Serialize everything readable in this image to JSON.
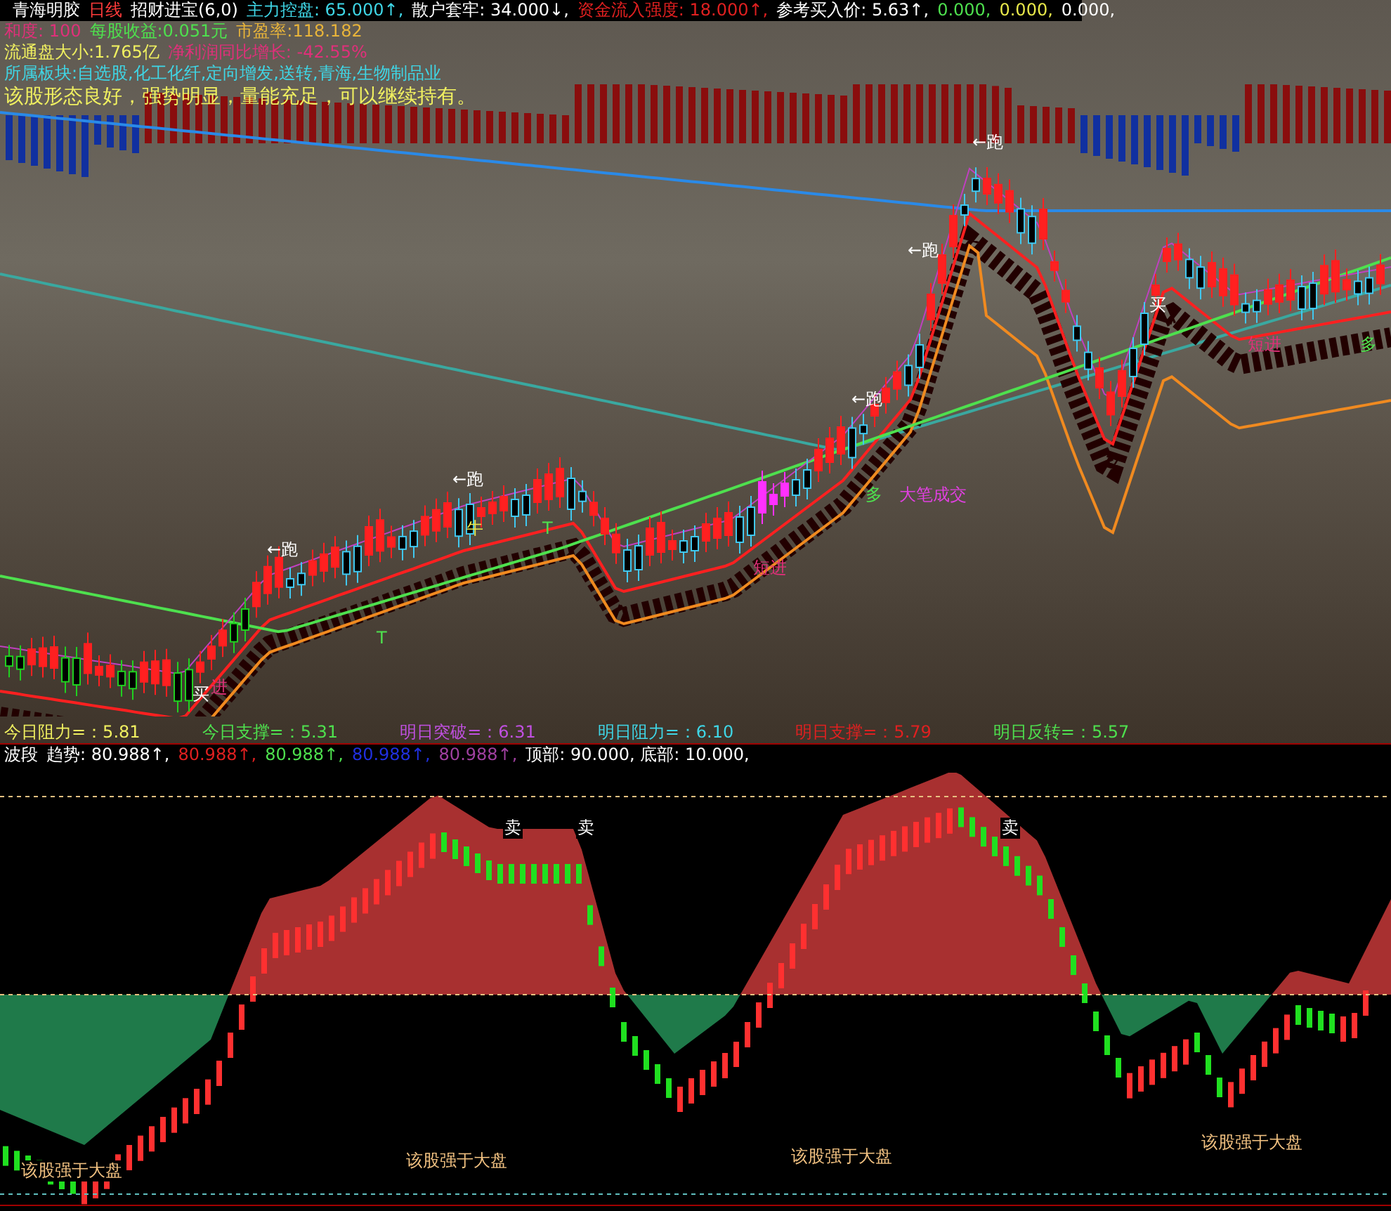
{
  "header_lines": [
    [
      {
        "text": "青海明胶",
        "color": "#ffffff"
      },
      {
        "text": "日线",
        "color": "#ff3b3b"
      },
      {
        "text": "招财进宝(6,0)",
        "color": "#ffffff"
      },
      {
        "text": "主力控盘: 65.000↑,",
        "color": "#3fd6e6"
      },
      {
        "text": "散户套牢: 34.000↓,",
        "color": "#ffffff"
      },
      {
        "text": "资金流入强度: 18.000↑,",
        "color": "#e02020"
      },
      {
        "text": "参考买入价: 5.63↑,",
        "color": "#ffffff"
      },
      {
        "text": "0.000,",
        "color": "#4ee04e"
      },
      {
        "text": "0.000,",
        "color": "#e8e84a"
      },
      {
        "text": "0.000,",
        "color": "#ffffff"
      }
    ],
    [
      {
        "text": "和度: 100",
        "color": "#e0307a"
      },
      {
        "text": "每股收益:0.051元",
        "color": "#4ee04e"
      },
      {
        "text": "市盈率:118.182",
        "color": "#e8b43a"
      }
    ],
    [
      {
        "text": "流通盘大小:1.765亿",
        "color": "#f0f060"
      },
      {
        "text": "净利润同比增长: -42.55%",
        "color": "#e0307a"
      }
    ],
    [
      {
        "text": "所属板块:自选股,化工化纤,定向增发,送转,青海,生物制品业",
        "color": "#3fd6e6"
      }
    ],
    [
      {
        "text": "该股形态良好，强势明显，量能充足，可以继续持有。",
        "color": "#f0f060"
      }
    ]
  ],
  "chart_labels": [
    {
      "text": "←跑",
      "color": "#ffffff"
    },
    {
      "text": "←跑",
      "color": "#ffffff"
    },
    {
      "text": "←跑",
      "color": "#ffffff"
    },
    {
      "text": "←跑",
      "color": "#ffffff"
    },
    {
      "text": "←跑",
      "color": "#ffffff"
    },
    {
      "text": "买",
      "color": "#ffffff"
    },
    {
      "text": "短进",
      "color": "#e0307a"
    },
    {
      "text": "多",
      "color": "#4ee04e"
    },
    {
      "text": "多",
      "color": "#4ee04e"
    },
    {
      "text": "大笔成交",
      "color": "#e040e0"
    },
    {
      "text": "牛",
      "color": "#e8e84a"
    },
    {
      "text": "T",
      "color": "#4ee04e"
    },
    {
      "text": "T",
      "color": "#4ee04e"
    },
    {
      "text": "短进",
      "color": "#e0307a"
    },
    {
      "text": "买",
      "color": "#ffffff"
    },
    {
      "text": "进",
      "color": "#e0307a"
    }
  ],
  "levels": [
    {
      "text": "今日阻力=：5.81",
      "color": "#f0f060"
    },
    {
      "text": "今日支撑=：5.31",
      "color": "#4ee04e"
    },
    {
      "text": "明日突破=：6.31",
      "color": "#c050e0"
    },
    {
      "text": "明日阻力=：6.10",
      "color": "#3fd6e6"
    },
    {
      "text": "明日支撑=：5.79",
      "color": "#e02020"
    },
    {
      "text": "明日反转=：5.57",
      "color": "#4ee04e"
    }
  ],
  "oscillator": {
    "title": "波段",
    "values": [
      {
        "text": "趋势: 80.988↑,",
        "color": "#ffffff"
      },
      {
        "text": "80.988↑,",
        "color": "#e02020"
      },
      {
        "text": "80.988↑,",
        "color": "#4ee04e"
      },
      {
        "text": "80.988↑,",
        "color": "#2030e0"
      },
      {
        "text": "80.988↑,",
        "color": "#a040a0"
      },
      {
        "text": "顶部: 90.000, 底部: 10.000,",
        "color": "#ffffff"
      }
    ],
    "signals": [
      "卖",
      "卖",
      "卖"
    ],
    "notes": [
      "该股强于大盘",
      "该股强于大盘",
      "该股强于大盘",
      "该股强于大盘"
    ]
  }
}
